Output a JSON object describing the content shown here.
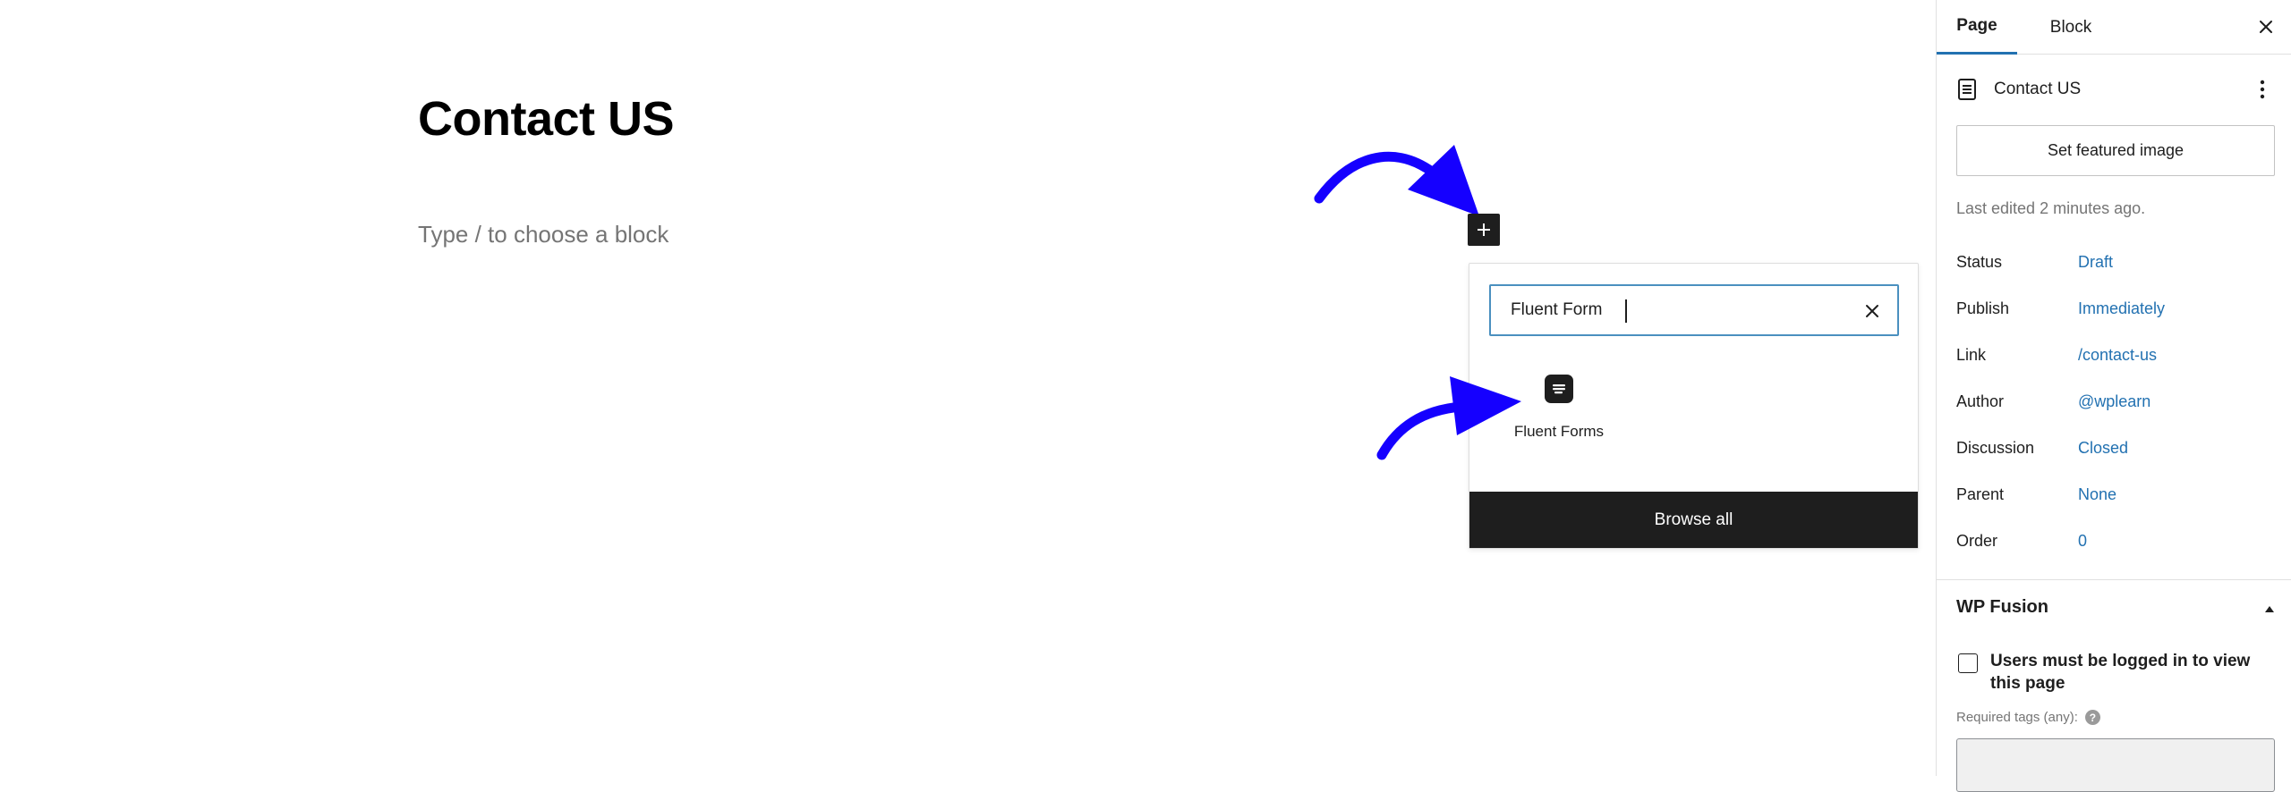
{
  "editor": {
    "page_title": "Contact US",
    "block_placeholder": "Type / to choose a block"
  },
  "inserter": {
    "search_value": "Fluent Form",
    "results": [
      {
        "label": "Fluent Forms",
        "icon": "fluent-forms-icon"
      }
    ],
    "browse_all_label": "Browse all"
  },
  "sidebar": {
    "tabs": [
      {
        "label": "Page",
        "active": true
      },
      {
        "label": "Block",
        "active": false
      }
    ],
    "document_title": "Contact US",
    "featured_image_label": "Set featured image",
    "last_edited": "Last edited 2 minutes ago.",
    "meta": [
      {
        "label": "Status",
        "value": "Draft"
      },
      {
        "label": "Publish",
        "value": "Immediately"
      },
      {
        "label": "Link",
        "value": "/contact-us"
      },
      {
        "label": "Author",
        "value": "@wplearn"
      },
      {
        "label": "Discussion",
        "value": "Closed"
      },
      {
        "label": "Parent",
        "value": "None"
      },
      {
        "label": "Order",
        "value": "0"
      }
    ],
    "wp_fusion": {
      "title": "WP Fusion",
      "logged_in_label": "Users must be logged in to view this page",
      "logged_in_checked": false,
      "required_tags_label": "Required tags (any):"
    }
  },
  "colors": {
    "accent": "#2271b1",
    "arrow": "#1500ff",
    "dark": "#1e1e1e"
  }
}
